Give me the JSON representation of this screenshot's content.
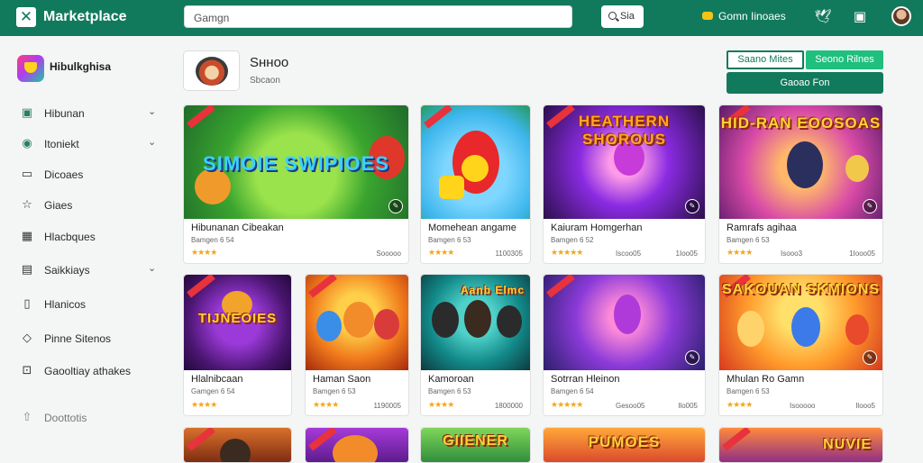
{
  "topbar": {
    "logo_glyph": "✕",
    "brand": "Marketplace",
    "search_placeholder": "Gamgn",
    "search_button": "Sia",
    "coins_label": "Gomn  Iinoaes",
    "icons": [
      "coin-icon",
      "bird-icon",
      "bookmark-icon",
      "user-avatar"
    ]
  },
  "sidebar": {
    "app_name": "Hibulkghisa",
    "items": [
      {
        "label": "Hibunan",
        "icon": "grid-icon",
        "expandable": true
      },
      {
        "label": "Itoniekt",
        "icon": "gamepad-icon",
        "expandable": true
      },
      {
        "label": "Dicoaes",
        "icon": "chat-icon",
        "expandable": false
      },
      {
        "label": "Giaes",
        "icon": "star-icon",
        "expandable": false
      },
      {
        "label": "Hlacbques",
        "icon": "table-icon",
        "expandable": false
      },
      {
        "label": "Saikkiays",
        "icon": "list-icon",
        "expandable": true
      },
      {
        "label": "Hlanicos",
        "icon": "page-icon",
        "expandable": false
      },
      {
        "label": "Pinne Sitenos",
        "icon": "tag-icon",
        "expandable": false
      },
      {
        "label": "Gaooltiay athakes",
        "icon": "lock-icon",
        "expandable": false
      },
      {
        "label": "Doottotis",
        "icon": "thumb-icon",
        "expandable": false
      }
    ]
  },
  "game_header": {
    "title": "Ѕнноо",
    "subtitle": "Sbcaon",
    "btn_secondary": "Saano Mites",
    "btn_primary_light": "Seono Rilnes",
    "btn_primary": "Gaoao Fon"
  },
  "cards": [
    {
      "title": "Hibunanan Cibeakan",
      "sub": "Bamgen 6 54",
      "stars": "★★★★",
      "count": "Sooooo",
      "art_title": "SIMOIE SWIPIOES"
    },
    {
      "title": "Momehean angame",
      "sub": "Bamgen 6 53",
      "stars": "★★★★",
      "count": "1100305",
      "art_title": ""
    },
    {
      "title": "Kaiuram Homgerhan",
      "sub": "Bamgen 6 52",
      "stars": "★★★★★",
      "count": "Iscoo05",
      "count2": "1Ioo05",
      "art_title": "HEATHERN SHOROUS"
    },
    {
      "title": "Ramrafs agihaa",
      "sub": "Bamgen 6 53",
      "stars": "★★★★",
      "count": "Isooo3",
      "count2": "1Iooo05",
      "art_title": "HID-RAN EOOSOAS"
    },
    {
      "title": "Hlalnibcaan",
      "sub": "Gamgen 6 54",
      "stars": "★★★★",
      "count": "",
      "art_title": "TIJNEOIES"
    },
    {
      "title": "Haman Saon",
      "sub": "Bamgen 6 53",
      "stars": "★★★★",
      "count": "1190005",
      "art_title": ""
    },
    {
      "title": "Kamoroan",
      "sub": "Bamgen 6 53",
      "stars": "★★★★",
      "count": "1800000",
      "art_title": "Aanb Elmc"
    },
    {
      "title": "Sotrran Hleinon",
      "sub": "Bamgen 6 54",
      "stars": "★★★★★",
      "count": "Gesoo05",
      "count2": "Ilo005",
      "art_title": ""
    },
    {
      "title": "Mhulan Ro Gamn",
      "sub": "Bamgen 6 53",
      "stars": "★★★★",
      "count": "Isooooo",
      "count2": "Ilooo5",
      "art_title": "SAKOUAN SKMIONS"
    },
    {
      "title": "",
      "sub": "",
      "stars": "",
      "count": "",
      "art_title": ""
    },
    {
      "title": "",
      "sub": "",
      "stars": "",
      "count": "",
      "art_title": ""
    },
    {
      "title": "",
      "sub": "",
      "stars": "",
      "count": "",
      "art_title": "GIIENER"
    },
    {
      "title": "",
      "sub": "",
      "stars": "",
      "count": "",
      "art_title": "PUMOES"
    },
    {
      "title": "",
      "sub": "",
      "stars": "",
      "count": "",
      "art_title": "NUVIE"
    }
  ],
  "colors": {
    "brand_green": "#127a5c",
    "accent_green": "#1fbf7e",
    "star": "#f0a81a",
    "badge_red": "#e8323c"
  }
}
